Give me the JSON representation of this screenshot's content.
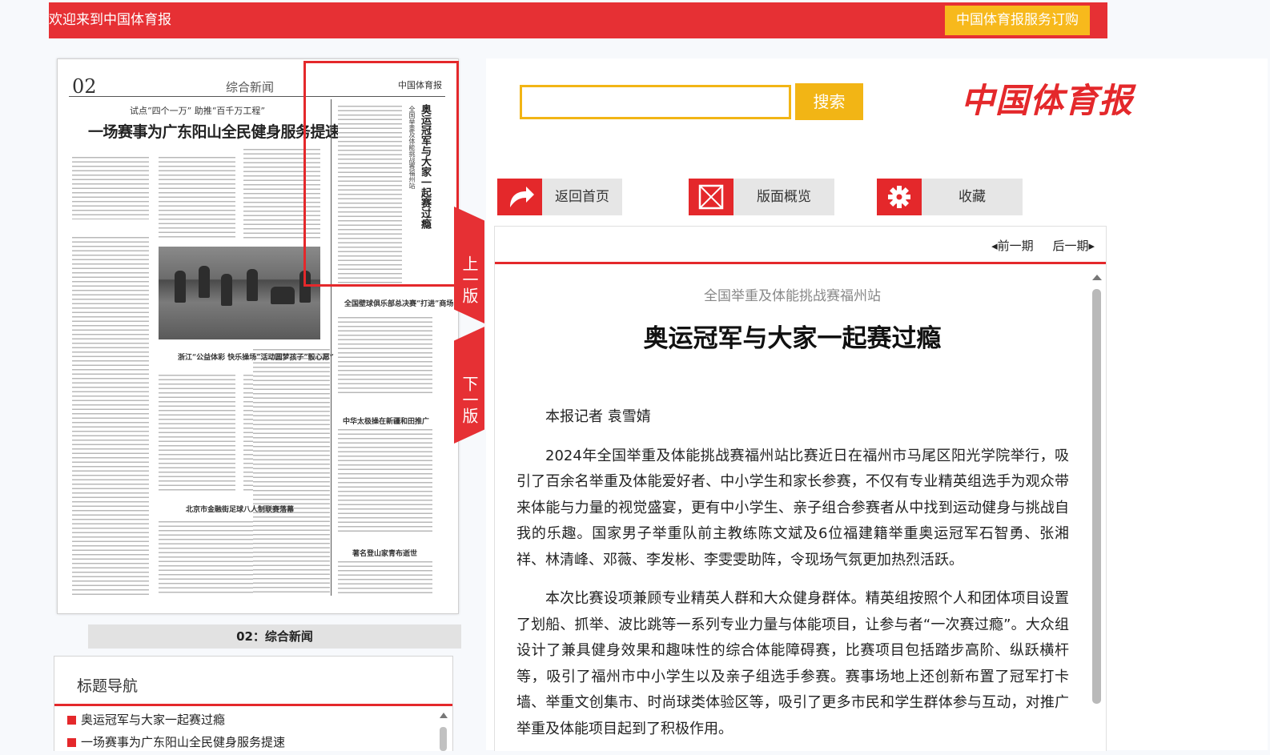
{
  "header": {
    "welcome": "欢迎来到中国体育报",
    "subscribe_label": "中国体育报服务订购"
  },
  "newspaper_page": {
    "page_number": "02",
    "section_name": "综合新闻",
    "masthead_small": "中国体育报",
    "kicker": "试点“四个一万” 助推“百千万工程”",
    "headline": "一场赛事为广东阳山全民健身服务提速",
    "vertical_kicker": "全国举重及体能挑战赛福州站",
    "vertical_title": "奥运冠军与大家一起赛过瘾",
    "sub_headlines": [
      "全国壁球俱乐部总决赛“打进”商场",
      "浙江“公益体彩 快乐操场”活动圆梦孩子“骰心愿”",
      "中华太极操在新疆和田推广",
      "北京市金融街足球八人制联赛落幕",
      "著名登山家青布逝世"
    ],
    "caption": "02：综合新闻"
  },
  "page_tabs": {
    "prev_label": "上一版",
    "next_label": "下一版"
  },
  "title_nav": {
    "heading": "标题导航",
    "items": [
      "奥运冠军与大家一起赛过瘾",
      "一场赛事为广东阳山全民健身服务提速"
    ]
  },
  "search": {
    "value": "",
    "placeholder": "",
    "button_label": "搜索"
  },
  "logo_text": "中国体育报",
  "toolbar": {
    "home_label": "返回首页",
    "overview_label": "版面概览",
    "favorite_label": "收藏"
  },
  "issue_nav": {
    "prev_label": "前一期",
    "next_label": "后一期"
  },
  "article": {
    "kicker": "全国举重及体能挑战赛福州站",
    "title": "奥运冠军与大家一起赛过瘾",
    "byline": "本报记者 袁雪婧",
    "paragraphs": [
      "2024年全国举重及体能挑战赛福州站比赛近日在福州市马尾区阳光学院举行，吸引了百余名举重及体能爱好者、中小学生和家长参赛，不仅有专业精英组选手为观众带来体能与力量的视觉盛宴，更有中小学生、亲子组合参赛者从中找到运动健身与挑战自我的乐趣。国家男子举重队前主教练陈文斌及6位福建籍举重奥运冠军石智勇、张湘祥、林清峰、邓薇、李发彬、李雯雯助阵，令现场气氛更加热烈活跃。",
      "本次比赛设项兼顾专业精英人群和大众健身群体。精英组按照个人和团体项目设置了划船、抓举、波比跳等一系列专业力量与体能项目，让参与者“一次赛过瘾”。大众组设计了兼具健身效果和趣味性的综合体能障碍赛，比赛项目包括踏步高阶、纵跃横杆等，吸引了福州市中小学生以及亲子组选手参赛。赛事场地上还创新布置了冠军打卡墙、举重文创集市、时尚球类体验区等，吸引了更多市民和学生群体参与互动，对推广举重及体能项目起到了积极作用。"
    ]
  },
  "colors": {
    "brand_red": "#e4282b",
    "accent_yellow": "#f2b515"
  }
}
